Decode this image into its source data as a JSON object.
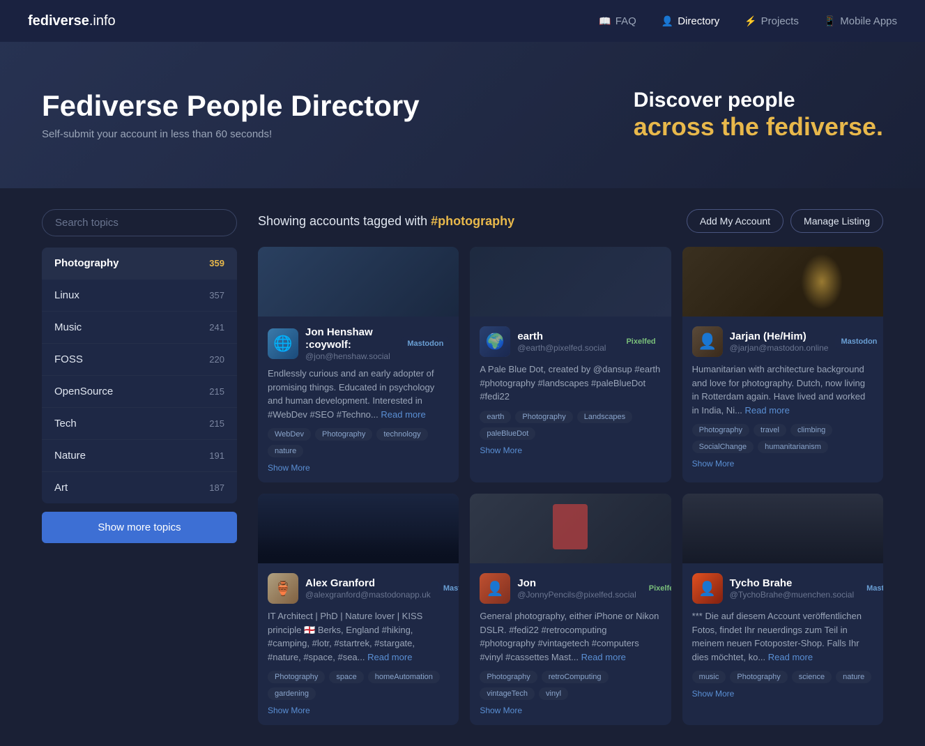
{
  "nav": {
    "brand": "fediverse",
    "brand_suffix": ".info",
    "links": [
      {
        "id": "faq",
        "label": "FAQ",
        "icon": "📖",
        "active": false
      },
      {
        "id": "directory",
        "label": "Directory",
        "icon": "👤",
        "active": true
      },
      {
        "id": "projects",
        "label": "Projects",
        "icon": "⚡",
        "active": false
      },
      {
        "id": "mobile-apps",
        "label": "Mobile Apps",
        "icon": "📱",
        "active": false
      }
    ]
  },
  "hero": {
    "title": "Fediverse People Directory",
    "subtitle": "Self-submit your account in less than 60 seconds!",
    "discover_line1": "Discover people",
    "discover_line2": "across the fediverse."
  },
  "sidebar": {
    "search_placeholder": "Search topics",
    "show_more_label": "Show more topics",
    "topics": [
      {
        "name": "Photography",
        "count": 359,
        "active": true
      },
      {
        "name": "Linux",
        "count": 357,
        "active": false
      },
      {
        "name": "Music",
        "count": 241,
        "active": false
      },
      {
        "name": "FOSS",
        "count": 220,
        "active": false
      },
      {
        "name": "OpenSource",
        "count": 215,
        "active": false
      },
      {
        "name": "Tech",
        "count": 215,
        "active": false
      },
      {
        "name": "Nature",
        "count": 191,
        "active": false
      },
      {
        "name": "Art",
        "count": 187,
        "active": false
      }
    ]
  },
  "content": {
    "showing_prefix": "Showing accounts tagged with ",
    "tag": "#photography",
    "add_account_label": "Add My Account",
    "manage_listing_label": "Manage Listing",
    "cards": [
      {
        "id": "jon-henshaw",
        "name": "Jon Henshaw :coywolf:",
        "handle": "@jon@henshaw.social",
        "platform": "Mastodon",
        "platform_type": "mastodon",
        "bio": "Endlessly curious and an early adopter of promising things. Educated in psychology and human development. Interested in #WebDev #SEO #Techno...",
        "read_more": "Read more",
        "tags": [
          "WebDev",
          "Photography",
          "technology",
          "nature"
        ],
        "show_more": "Show More"
      },
      {
        "id": "earth",
        "name": "earth",
        "handle": "@earth@pixelfed.social",
        "platform": "Pixelfed",
        "platform_type": "pixelfed",
        "bio": "A Pale Blue Dot, created by @dansup #earth #photography #landscapes #paleBlueDot #fedi22",
        "read_more": "",
        "tags": [
          "earth",
          "Photography",
          "Landscapes",
          "paleBlueDot"
        ],
        "show_more": "Show More"
      },
      {
        "id": "jarjan",
        "name": "Jarjan (He/Him)",
        "handle": "@jarjan@mastodon.online",
        "platform": "Mastodon",
        "platform_type": "mastodon",
        "bio": "Humanitarian with architecture background and love for photography. Dutch, now living in Rotterdam again. Have lived and worked in India, Ni...",
        "read_more": "Read more",
        "tags": [
          "Photography",
          "travel",
          "climbing",
          "SocialChange",
          "humanitarianism"
        ],
        "show_more": "Show More"
      },
      {
        "id": "alex-granford",
        "name": "Alex Granford",
        "handle": "@alexgranford@mastodonapp.uk",
        "platform": "Mastodon",
        "platform_type": "mastodon",
        "bio": "IT Architect | PhD | Nature lover | KISS principle 🏴󠁧󠁢󠁥󠁮󠁧󠁿 Berks, England #hiking, #camping, #lotr, #startrek, #stargate, #nature, #space, #sea...",
        "read_more": "Read more",
        "tags": [
          "Photography",
          "space",
          "homeAutomation",
          "gardening"
        ],
        "show_more": "Show More"
      },
      {
        "id": "jon-pencils",
        "name": "Jon",
        "handle": "@JonnyPencils@pixelfed.social",
        "platform": "Pixelfed",
        "platform_type": "pixelfed",
        "bio": "General photography, either iPhone or Nikon DSLR. #fedi22 #retrocomputing #photography #vintagetech #computers #vinyl #cassettes Mast...",
        "read_more": "Read more",
        "tags": [
          "Photography",
          "retroComputing",
          "vintageTech",
          "vinyl"
        ],
        "show_more": "Show More"
      },
      {
        "id": "tycho-brahe",
        "name": "Tycho Brahe",
        "handle": "@TychoBrahe@muenchen.social",
        "platform": "Mastodon",
        "platform_type": "mastodon",
        "bio": "*** Die auf diesem Account veröffentlichen Fotos, findet Ihr neuerdings zum Teil in meinem neuen Fotoposter-Shop. Falls Ihr dies möchtet, ko...",
        "read_more": "Read more",
        "tags": [
          "music",
          "Photography",
          "science",
          "nature"
        ],
        "show_more": "Show More"
      }
    ]
  }
}
